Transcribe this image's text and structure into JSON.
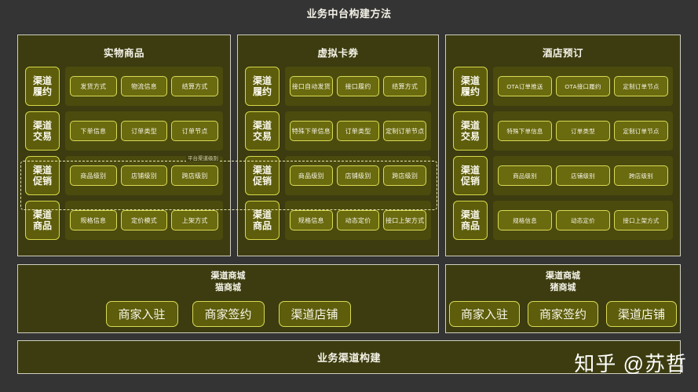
{
  "title": "业务中台构建方法",
  "overlay": {
    "dashed_label": "平台渠道级别"
  },
  "panels": [
    {
      "title": "实物商品",
      "rows": [
        {
          "label_line1": "渠道",
          "label_line2": "履约",
          "items": [
            "发货方式",
            "物流信息",
            "结算方式"
          ]
        },
        {
          "label_line1": "渠道",
          "label_line2": "交易",
          "items": [
            "下单信息",
            "订单类型",
            "订单节点"
          ]
        },
        {
          "label_line1": "渠道",
          "label_line2": "促销",
          "items": [
            "商品级别",
            "店铺级别",
            "跨店级别"
          ]
        },
        {
          "label_line1": "渠道",
          "label_line2": "商品",
          "items": [
            "规格信息",
            "定价模式",
            "上架方式"
          ]
        }
      ]
    },
    {
      "title": "虚拟卡券",
      "rows": [
        {
          "label_line1": "渠道",
          "label_line2": "履约",
          "items": [
            "接口自动发货",
            "接口履约",
            "结算方式"
          ]
        },
        {
          "label_line1": "渠道",
          "label_line2": "交易",
          "items": [
            "特殊下单信息",
            "订单类型",
            "定制订单节点"
          ]
        },
        {
          "label_line1": "渠道",
          "label_line2": "促销",
          "items": [
            "商品级别",
            "店铺级别",
            "跨店级别"
          ]
        },
        {
          "label_line1": "渠道",
          "label_line2": "商品",
          "items": [
            "规格信息",
            "动态定价",
            "接口上架方式"
          ]
        }
      ]
    },
    {
      "title": "酒店预订",
      "rows": [
        {
          "label_line1": "渠道",
          "label_line2": "履约",
          "items": [
            "OTA订单推送",
            "OTA接口履约",
            "定制订单节点"
          ]
        },
        {
          "label_line1": "渠道",
          "label_line2": "交易",
          "items": [
            "特殊下单信息",
            "订单类型",
            "定制订单节点"
          ]
        },
        {
          "label_line1": "渠道",
          "label_line2": "促销",
          "items": [
            "商品级别",
            "店铺级别",
            "跨店级别"
          ]
        },
        {
          "label_line1": "渠道",
          "label_line2": "商品",
          "items": [
            "规格信息",
            "动态定价",
            "接口上架方式"
          ]
        }
      ]
    }
  ],
  "malls": [
    {
      "title_line1": "渠道商城",
      "title_line2": "猫商城",
      "buttons": [
        "商家入驻",
        "商家签约",
        "渠道店铺"
      ]
    },
    {
      "title_line1": "渠道商城",
      "title_line2": "猪商城",
      "buttons": [
        "商家入驻",
        "商家签约",
        "渠道店铺"
      ]
    }
  ],
  "footer": {
    "title": "业务渠道构建"
  },
  "watermark": "知乎 @苏哲",
  "colors": {
    "page_bg": "#343434",
    "panel_bg": "#3c3c10",
    "panel_border": "#cfcfc0",
    "row_body_bg": "#4b4b0e",
    "label_bg": "#5d5d0c",
    "pill_bg": "#6a6a0f",
    "accent_border": "#d9da55",
    "text": "#f5f3e8"
  }
}
